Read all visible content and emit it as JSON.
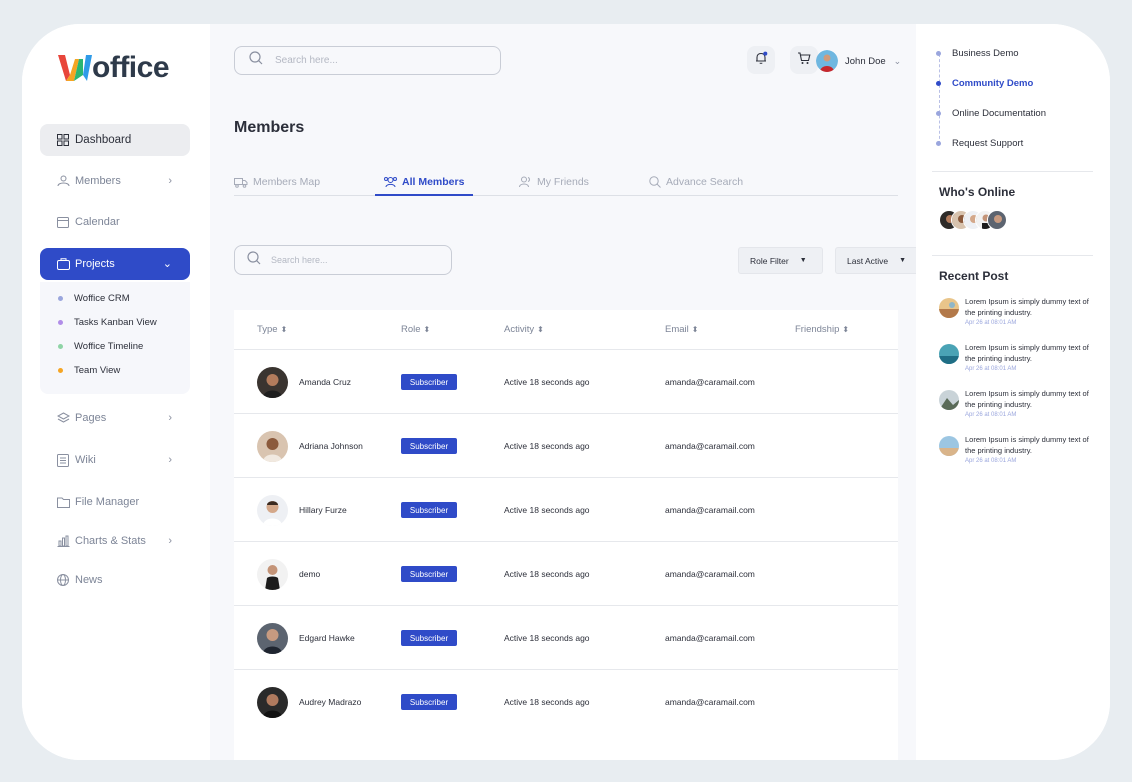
{
  "brand": {
    "logo_text": "Woffice"
  },
  "sidebar": {
    "items": [
      {
        "label": "Dashboard",
        "icon": "grid-icon"
      },
      {
        "label": "Members",
        "icon": "members-icon"
      },
      {
        "label": "Calendar",
        "icon": "calendar-icon"
      },
      {
        "label": "Projects",
        "icon": "folder-icon"
      },
      {
        "label": "Pages",
        "icon": "layers-icon"
      },
      {
        "label": "Wiki",
        "icon": "document-icon"
      },
      {
        "label": "File Manager",
        "icon": "file-folder-icon"
      },
      {
        "label": "Charts & Stats",
        "icon": "chart-icon"
      },
      {
        "label": "News",
        "icon": "globe-icon"
      }
    ],
    "projects_sub": [
      {
        "label": "Woffice CRM",
        "color": "#9aa6dd"
      },
      {
        "label": "Tasks Kanban View",
        "color": "#b18de8"
      },
      {
        "label": "Woffice Timeline",
        "color": "#8fd4a6"
      },
      {
        "label": "Team View",
        "color": "#f5a524"
      }
    ]
  },
  "header": {
    "search_placeholder": "Search here...",
    "user_name": "John Doe",
    "notification_color": "#2f4bc8"
  },
  "main": {
    "title": "Members",
    "tabs": [
      {
        "label": "Members Map",
        "icon": "truck-icon"
      },
      {
        "label": "All Members",
        "icon": "users-icon"
      },
      {
        "label": "My Friends",
        "icon": "friends-icon"
      },
      {
        "label": "Advance Search",
        "icon": "search-icon"
      }
    ],
    "member_search_placeholder": "Search here...",
    "role_filter": "Role Filter",
    "sort_filter": "Last Active",
    "columns": [
      "Type",
      "Role",
      "Activity",
      "Email",
      "Friendship"
    ],
    "members": [
      {
        "name": "Amanda Cruz",
        "role": "Subscriber",
        "activity": "Active 18 seconds ago",
        "email": "amanda@caramail.com"
      },
      {
        "name": "Adriana Johnson",
        "role": "Subscriber",
        "activity": "Active 18 seconds ago",
        "email": "amanda@caramail.com"
      },
      {
        "name": "Hillary Furze",
        "role": "Subscriber",
        "activity": "Active 18 seconds ago",
        "email": "amanda@caramail.com"
      },
      {
        "name": "demo",
        "role": "Subscriber",
        "activity": "Active 18 seconds ago",
        "email": "amanda@caramail.com"
      },
      {
        "name": "Edgard Hawke",
        "role": "Subscriber",
        "activity": "Active 18 seconds ago",
        "email": "amanda@caramail.com"
      },
      {
        "name": "Audrey Madrazo",
        "role": "Subscriber",
        "activity": "Active 18 seconds ago",
        "email": "amanda@caramail.com"
      }
    ]
  },
  "right": {
    "links": [
      "Business Demo",
      "Community Demo",
      "Online Documentation",
      "Request Support"
    ],
    "active_link": "Community Demo",
    "whos_online_title": "Who's Online",
    "recent_post_title": "Recent Post",
    "posts": [
      {
        "text": "Lorem Ipsum is simply dummy text of the printing industry.",
        "date": "Apr 26 at 08:01 AM"
      },
      {
        "text": "Lorem Ipsum is simply dummy text of the printing industry.",
        "date": "Apr 26 at 08:01 AM"
      },
      {
        "text": "Lorem Ipsum is simply dummy text of the printing industry.",
        "date": "Apr 26 at 08:01 AM"
      },
      {
        "text": "Lorem Ipsum is simply dummy text of the printing industry.",
        "date": "Apr 26 at 08:01 AM"
      }
    ]
  },
  "colors": {
    "accent": "#2f4bc8",
    "background": "#f7f8fb"
  }
}
